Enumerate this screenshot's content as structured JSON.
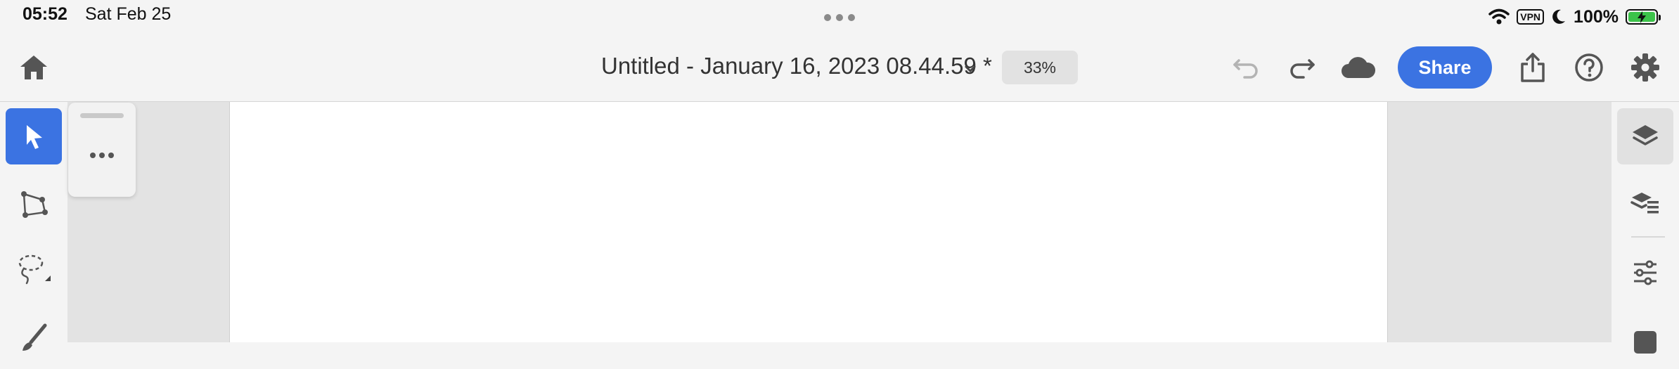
{
  "status_bar": {
    "time": "05:52",
    "date": "Sat Feb 25",
    "vpn_label": "VPN",
    "battery_percent": "100%",
    "battery_level": 1.0,
    "battery_color": "#3cc34a"
  },
  "toolbar": {
    "home_icon": "home-icon",
    "document_title": "Untitled - January 16, 2023 08.44.59 *",
    "zoom_label": "33%",
    "undo_icon": "undo-icon",
    "redo_icon": "redo-icon",
    "cloud_icon": "cloud-icon",
    "share_label": "Share",
    "export_icon": "export-icon",
    "help_icon": "help-icon",
    "settings_icon": "gear-icon"
  },
  "left_tools": [
    {
      "name": "selection-tool",
      "icon": "arrow-pointer-icon",
      "active": true
    },
    {
      "name": "direct-selection-tool",
      "icon": "polygon-anchor-icon",
      "active": false
    },
    {
      "name": "lasso-tool",
      "icon": "lasso-icon",
      "active": false
    },
    {
      "name": "brush-tool",
      "icon": "brush-icon",
      "active": false
    }
  ],
  "right_panels": [
    {
      "name": "layers-panel",
      "icon": "layers-icon",
      "active": true
    },
    {
      "name": "layer-properties-panel",
      "icon": "layers-list-icon",
      "active": false
    },
    {
      "name": "adjustments-panel",
      "icon": "sliders-icon",
      "active": false
    },
    {
      "name": "color-panel",
      "icon": "color-swatch-icon",
      "active": false
    }
  ],
  "colors": {
    "accent": "#3b73e2",
    "chrome_bg": "#f4f4f4",
    "canvas_bg": "#e3e3e3",
    "artboard": "#ffffff"
  }
}
